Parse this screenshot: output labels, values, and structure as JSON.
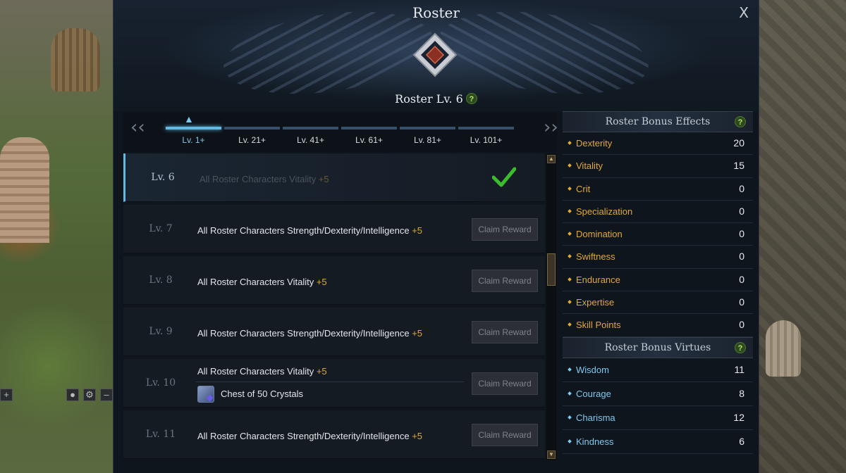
{
  "window": {
    "title": "Roster",
    "close_label": "X"
  },
  "roster_level": {
    "label": "Roster Lv. 6",
    "help": "?"
  },
  "tabs": [
    {
      "label": "Lv. 1+",
      "active": true
    },
    {
      "label": "Lv. 21+",
      "active": false
    },
    {
      "label": "Lv. 41+",
      "active": false
    },
    {
      "label": "Lv. 61+",
      "active": false
    },
    {
      "label": "Lv. 81+",
      "active": false
    },
    {
      "label": "Lv. 101+",
      "active": false
    }
  ],
  "rewards": [
    {
      "level": "Lv. 6",
      "text": "All Roster Characters Vitality",
      "bonus": "+5",
      "status": "claimed"
    },
    {
      "level": "Lv. 7",
      "text": "All Roster Characters Strength/Dexterity/Intelligence",
      "bonus": "+5",
      "button": "Claim Reward"
    },
    {
      "level": "Lv. 8",
      "text": "All Roster Characters Vitality",
      "bonus": "+5",
      "button": "Claim Reward"
    },
    {
      "level": "Lv. 9",
      "text": "All Roster Characters Strength/Dexterity/Intelligence",
      "bonus": "+5",
      "button": "Claim Reward"
    },
    {
      "level": "Lv. 10",
      "text": "All Roster Characters Vitality",
      "bonus": "+5",
      "item": "Chest of 50 Crystals",
      "button": "Claim Reward"
    },
    {
      "level": "Lv. 11",
      "text": "All Roster Characters Strength/Dexterity/Intelligence",
      "bonus": "+5",
      "button": "Claim Reward"
    }
  ],
  "bonus_effects": {
    "title": "Roster Bonus Effects",
    "help": "?",
    "stats": [
      {
        "name": "Dexterity",
        "value": "20"
      },
      {
        "name": "Vitality",
        "value": "15"
      },
      {
        "name": "Crit",
        "value": "0"
      },
      {
        "name": "Specialization",
        "value": "0"
      },
      {
        "name": "Domination",
        "value": "0"
      },
      {
        "name": "Swiftness",
        "value": "0"
      },
      {
        "name": "Endurance",
        "value": "0"
      },
      {
        "name": "Expertise",
        "value": "0"
      },
      {
        "name": "Skill Points",
        "value": "0"
      }
    ]
  },
  "bonus_virtues": {
    "title": "Roster Bonus Virtues",
    "help": "?",
    "stats": [
      {
        "name": "Wisdom",
        "value": "11"
      },
      {
        "name": "Courage",
        "value": "8"
      },
      {
        "name": "Charisma",
        "value": "12"
      },
      {
        "name": "Kindness",
        "value": "6"
      }
    ]
  },
  "colors": {
    "accent": "#5fbbe6",
    "bonus": "#e0a838",
    "virtue": "#7fc8ef",
    "check": "#3dbb2f"
  }
}
